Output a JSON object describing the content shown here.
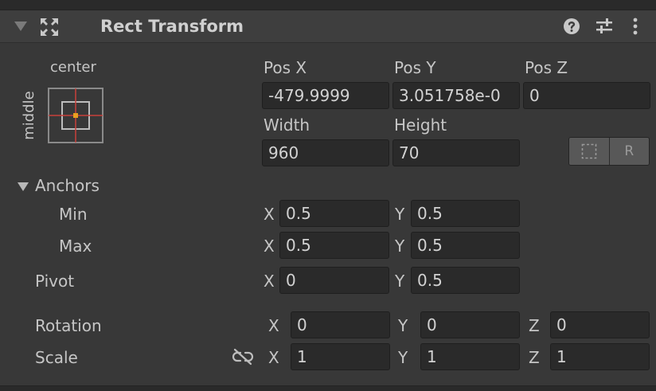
{
  "component": {
    "title": "Rect Transform"
  },
  "anchor_preset": {
    "horizontal": "center",
    "vertical": "middle"
  },
  "position": {
    "pos_x_label": "Pos X",
    "pos_y_label": "Pos Y",
    "pos_z_label": "Pos Z",
    "pos_x": "-479.9999",
    "pos_y": "3.051758e-0",
    "pos_z": "0",
    "width_label": "Width",
    "height_label": "Height",
    "width": "960",
    "height": "70"
  },
  "toolbar": {
    "raw_edit_label": "R"
  },
  "anchors": {
    "label": "Anchors",
    "min_label": "Min",
    "max_label": "Max",
    "min_x": "0.5",
    "min_y": "0.5",
    "max_x": "0.5",
    "max_y": "0.5"
  },
  "pivot": {
    "label": "Pivot",
    "x": "0",
    "y": "0.5"
  },
  "rotation": {
    "label": "Rotation",
    "x": "0",
    "y": "0",
    "z": "0"
  },
  "scale": {
    "label": "Scale",
    "x": "1",
    "y": "1",
    "z": "1"
  },
  "axis_labels": {
    "x": "X",
    "y": "Y",
    "z": "Z"
  },
  "colors": {
    "panel_bg": "#383838",
    "field_bg": "#2a2a2a",
    "crosshair_red": "#c8403a",
    "anchor_orange": "#e8a020"
  }
}
